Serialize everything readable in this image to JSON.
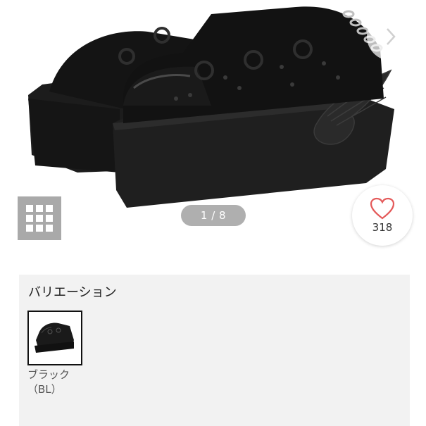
{
  "gallery": {
    "counter": "1 / 8",
    "favorite_count": "318",
    "icons": {
      "prev": "chevron-left-icon",
      "next": "chevron-right-icon",
      "grid": "grid-icon",
      "favorite": "heart-icon"
    }
  },
  "variation": {
    "title": "バリエーション",
    "items": [
      {
        "label": "ブラック（BL）",
        "selected": true
      }
    ]
  },
  "colors": {
    "accent_heart": "#e45a5a",
    "panel_bg": "#f2f2f2",
    "grid_button": "#a9a9a9"
  }
}
